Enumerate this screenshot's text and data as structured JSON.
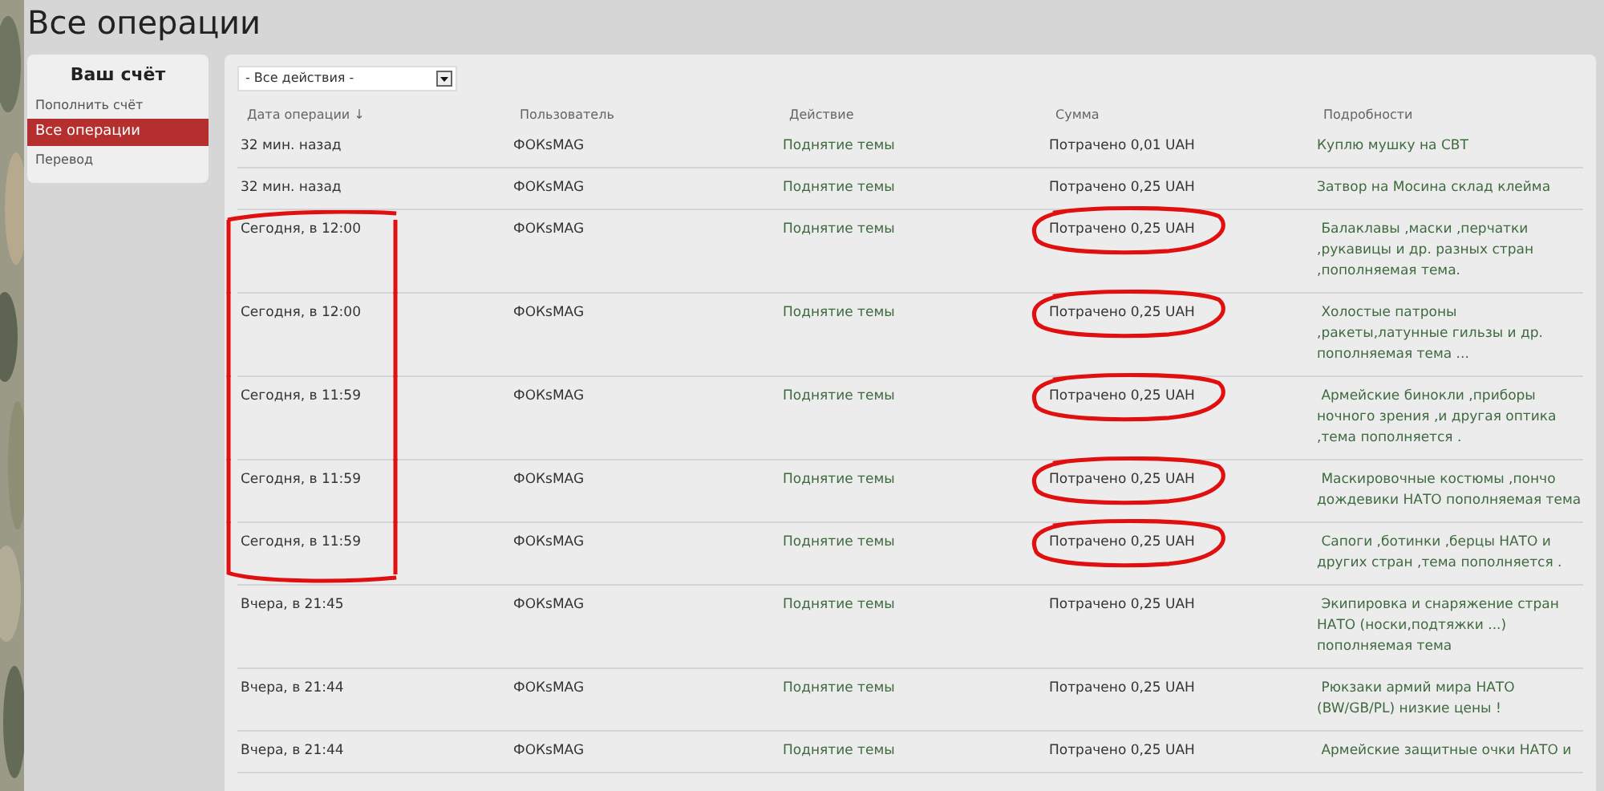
{
  "page_title": "Все операции",
  "sidebar": {
    "title": "Ваш счёт",
    "items": [
      {
        "label": "Пополнить счёт",
        "selected": false
      },
      {
        "label": "Все операции",
        "selected": true
      },
      {
        "label": "Перевод",
        "selected": false
      }
    ]
  },
  "filter": {
    "value": "- Все действия -"
  },
  "table": {
    "columns": [
      "Дата операции ↓",
      "Пользователь",
      "Действие",
      "Сумма",
      "Подробности"
    ],
    "rows": [
      {
        "date": "32 мин. назад",
        "user": "ФОКsMAG",
        "action": "Поднятие темы",
        "amount": "Потрачено 0,01 UAH",
        "details": "Куплю мушку на СВТ",
        "amount_circled": false,
        "date_circled": false
      },
      {
        "date": "32 мин. назад",
        "user": "ФОКsMAG",
        "action": "Поднятие темы",
        "amount": "Потрачено 0,25 UAH",
        "details": "Затвор на Мосина склад клейма",
        "amount_circled": false,
        "date_circled": false
      },
      {
        "date": "Сегодня, в 12:00",
        "user": "ФОКsMAG",
        "action": "Поднятие темы",
        "amount": "Потрачено 0,25 UAH",
        "details": " Балаклавы ,маски ,перчатки ,рукавицы и др. разных стран ,пополняемая тема.",
        "amount_circled": true,
        "date_circled": true
      },
      {
        "date": "Сегодня, в 12:00",
        "user": "ФОКsMAG",
        "action": "Поднятие темы",
        "amount": "Потрачено 0,25 UAH",
        "details": " Холостые патроны ,ракеты,латунные гильзы и др. пополняемая тема ...",
        "amount_circled": true,
        "date_circled": true
      },
      {
        "date": "Сегодня, в 11:59",
        "user": "ФОКsMAG",
        "action": "Поднятие темы",
        "amount": "Потрачено 0,25 UAH",
        "details": " Армейские бинокли ,приборы ночного зрения ,и другая оптика ,тема пополняется .",
        "amount_circled": true,
        "date_circled": true
      },
      {
        "date": "Сегодня, в 11:59",
        "user": "ФОКsMAG",
        "action": "Поднятие темы",
        "amount": "Потрачено 0,25 UAH",
        "details": " Маскировочные костюмы ,пончо дождевики НАТО пополняемая тема",
        "amount_circled": true,
        "date_circled": true
      },
      {
        "date": "Сегодня, в 11:59",
        "user": "ФОКsMAG",
        "action": "Поднятие темы",
        "amount": "Потрачено 0,25 UAH",
        "details": " Сапоги ,ботинки ,берцы НАТО и других стран ,тема пополняется .",
        "amount_circled": true,
        "date_circled": true
      },
      {
        "date": "Вчера, в 21:45",
        "user": "ФОКsMAG",
        "action": "Поднятие темы",
        "amount": "Потрачено 0,25 UAH",
        "details": " Экипировка и снаряжение стран НАТО (носки,подтяжки ...) пополняемая тема",
        "amount_circled": false,
        "date_circled": false
      },
      {
        "date": "Вчера, в 21:44",
        "user": "ФОКsMAG",
        "action": "Поднятие темы",
        "amount": "Потрачено 0,25 UAH",
        "details": " Рюкзаки армий мира НАТО (BW/GB/PL) низкие цены !",
        "amount_circled": false,
        "date_circled": false
      },
      {
        "date": "Вчера, в 21:44",
        "user": "ФОКsMAG",
        "action": "Поднятие темы",
        "amount": "Потрачено 0,25 UAH",
        "details": " Армейские защитные очки НАТО и",
        "amount_circled": false,
        "date_circled": false
      }
    ]
  }
}
